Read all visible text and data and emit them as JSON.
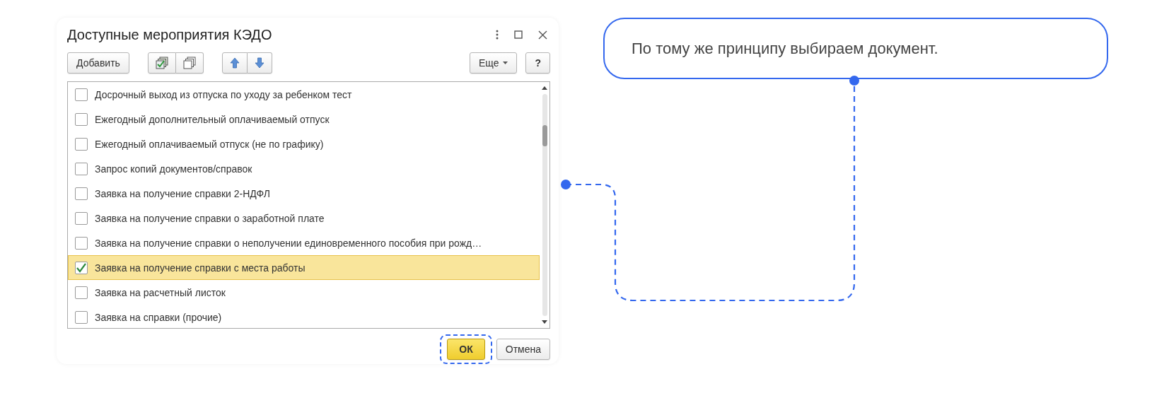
{
  "dialog": {
    "title": "Доступные мероприятия КЭДО",
    "toolbar": {
      "add_button": "Добавить",
      "more_button": "Еще",
      "help_button": "?"
    },
    "items": [
      {
        "text": "Досрочный выход из отпуска по уходу за ребенком тест",
        "checked": false,
        "selected": false
      },
      {
        "text": "Ежегодный дополнительный оплачиваемый отпуск",
        "checked": false,
        "selected": false
      },
      {
        "text": "Ежегодный оплачиваемый отпуск (не по графику)",
        "checked": false,
        "selected": false
      },
      {
        "text": "Запрос копий документов/справок",
        "checked": false,
        "selected": false
      },
      {
        "text": "Заявка на получение справки 2-НДФЛ",
        "checked": false,
        "selected": false
      },
      {
        "text": "Заявка на получение справки о заработной плате",
        "checked": false,
        "selected": false
      },
      {
        "text": "Заявка на получение справки о неполучении единовременного пособия при рожд…",
        "checked": false,
        "selected": false
      },
      {
        "text": "Заявка на получение справки с места работы",
        "checked": true,
        "selected": true
      },
      {
        "text": "Заявка на расчетный листок",
        "checked": false,
        "selected": false
      },
      {
        "text": "Заявка на справки (прочие)",
        "checked": false,
        "selected": false
      }
    ],
    "ok_button": "ОК",
    "cancel_button": "Отмена"
  },
  "callout": {
    "text": "По тому же принципу выбираем документ."
  }
}
